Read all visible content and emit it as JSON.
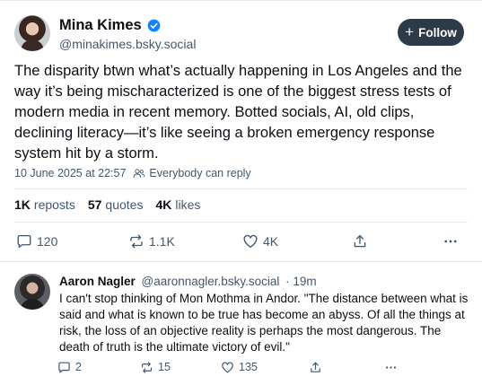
{
  "post": {
    "author": {
      "display_name": "Mina Kimes",
      "handle": "@minakimes.bsky.social",
      "verified": true
    },
    "follow_button": {
      "label": "Follow"
    },
    "text": "The disparity btwn what’s actually happening in Los Angeles and the way it’s being mischaracterized is one of the biggest stress tests of modern media in recent memory. Botted socials, AI, old clips, declining literacy—it’s like seeing a broken emergency response system hit by a storm.",
    "timestamp": "10 June 2025 at 22:57",
    "reply_setting": "Everybody can reply",
    "stats": {
      "reposts_count": "1K",
      "reposts_label": "reposts",
      "quotes_count": "57",
      "quotes_label": "quotes",
      "likes_count": "4K",
      "likes_label": "likes"
    },
    "actions": {
      "replies": "120",
      "reposts": "1.1K",
      "likes": "4K"
    }
  },
  "reply": {
    "author": {
      "display_name": "Aaron Nagler",
      "handle": "@aaronnagler.bsky.social",
      "age": "· 19m"
    },
    "text": "I can't stop thinking of Mon Mothma in Andor. \"The distance between what is said and what is known to be true has become an abyss. Of all the things at risk, the loss of an objective reality is perhaps the most dangerous. The death of truth is the ultimate victory of evil.\"",
    "actions": {
      "replies": "2",
      "reposts": "15",
      "likes": "135"
    }
  },
  "colors": {
    "text": "#0b0f14",
    "muted": "#42576c",
    "verified": "#1083fe",
    "follow_bg": "#2c3a4a",
    "divider": "#e3e8ee"
  }
}
